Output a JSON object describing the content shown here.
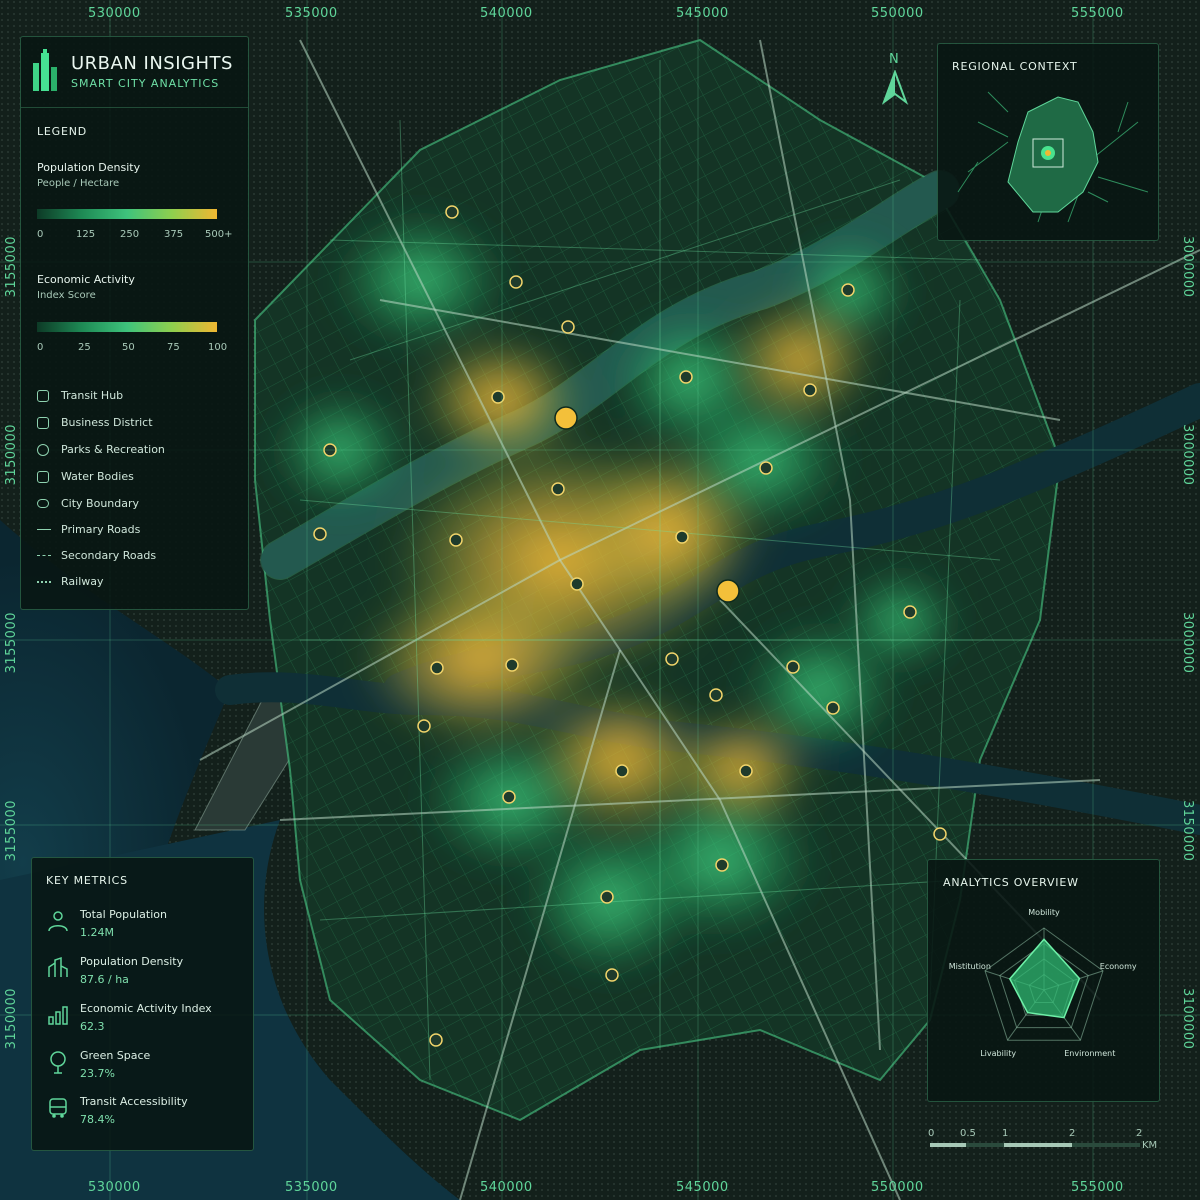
{
  "header": {
    "title": "URBAN INSIGHTS",
    "subtitle": "SMART CITY ANALYTICS"
  },
  "coords": {
    "x_ticks": [
      "530000",
      "535000",
      "540000",
      "545000",
      "550000",
      "555000"
    ],
    "y_ticks_left": [
      "3155000",
      "3150000",
      "3155000",
      "3155000",
      "3150000"
    ],
    "y_ticks_right": [
      "3000000",
      "3000000",
      "3000000",
      "3150000",
      "3100000"
    ]
  },
  "legend": {
    "title": "LEGEND",
    "population": {
      "title": "Population Density",
      "unit": "People / Hectare",
      "ticks": [
        "0",
        "125",
        "250",
        "375",
        "500+"
      ]
    },
    "economic": {
      "title": "Economic Activity",
      "unit": "Index Score",
      "ticks": [
        "0",
        "25",
        "50",
        "75",
        "100"
      ]
    },
    "items": [
      {
        "icon": "transit-hub-icon",
        "label": "Transit Hub"
      },
      {
        "icon": "business-district-icon",
        "label": "Business District"
      },
      {
        "icon": "parks-icon",
        "label": "Parks & Recreation"
      },
      {
        "icon": "water-bodies-icon",
        "label": "Water Bodies"
      },
      {
        "icon": "city-boundary-icon",
        "label": "City Boundary"
      },
      {
        "icon": "primary-road-icon",
        "label": "Primary Roads"
      },
      {
        "icon": "secondary-road-icon",
        "label": "Secondary Roads"
      },
      {
        "icon": "railway-icon",
        "label": "Railway"
      }
    ],
    "ramp_colors": [
      "#0d3a26",
      "#1e8a55",
      "#3ec37c",
      "#8fcf4e",
      "#f0b732"
    ]
  },
  "north": {
    "label": "N"
  },
  "regional": {
    "title": "REGIONAL CONTEXT"
  },
  "metrics": {
    "title": "KEY METRICS",
    "items": [
      {
        "icon": "population-icon",
        "label": "Total Population",
        "value": "1.24M"
      },
      {
        "icon": "density-icon",
        "label": "Population Density",
        "value": "87.6 / ha"
      },
      {
        "icon": "economy-icon",
        "label": "Economic Activity Index",
        "value": "62.3"
      },
      {
        "icon": "tree-icon",
        "label": "Green Space",
        "value": "23.7%"
      },
      {
        "icon": "bus-icon",
        "label": "Transit Accessibility",
        "value": "78.4%"
      }
    ]
  },
  "analytics": {
    "title": "ANALYTICS OVERVIEW",
    "axes": [
      "Mobility",
      "Economy",
      "Environment",
      "Livability",
      "Mistitution"
    ],
    "values": [
      0.82,
      0.6,
      0.55,
      0.45,
      0.58
    ]
  },
  "scale": {
    "ticks": [
      "0",
      "0.5",
      "1",
      "2",
      "2"
    ],
    "unit": "KM"
  },
  "colors": {
    "accent": "#46d38b",
    "hot": "#f0b732",
    "panel_border": "#5ac88c"
  }
}
